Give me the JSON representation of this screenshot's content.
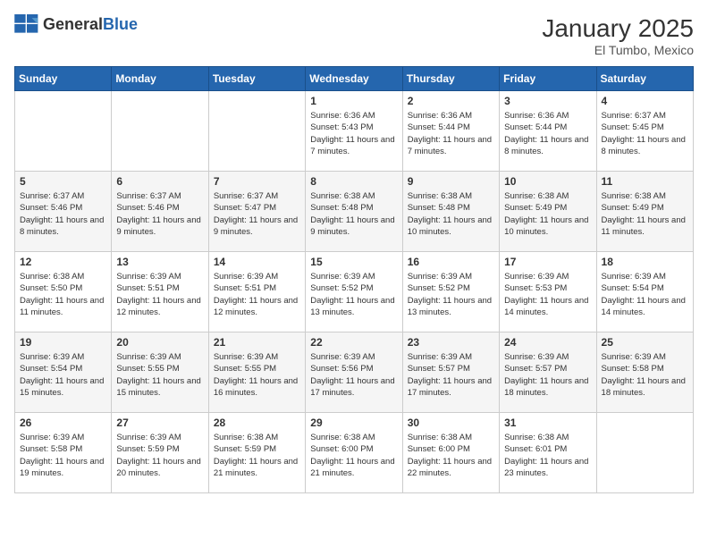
{
  "header": {
    "logo_general": "General",
    "logo_blue": "Blue",
    "month": "January 2025",
    "location": "El Tumbo, Mexico"
  },
  "days_of_week": [
    "Sunday",
    "Monday",
    "Tuesday",
    "Wednesday",
    "Thursday",
    "Friday",
    "Saturday"
  ],
  "weeks": [
    [
      {
        "day": "",
        "info": ""
      },
      {
        "day": "",
        "info": ""
      },
      {
        "day": "",
        "info": ""
      },
      {
        "day": "1",
        "info": "Sunrise: 6:36 AM\nSunset: 5:43 PM\nDaylight: 11 hours and 7 minutes."
      },
      {
        "day": "2",
        "info": "Sunrise: 6:36 AM\nSunset: 5:44 PM\nDaylight: 11 hours and 7 minutes."
      },
      {
        "day": "3",
        "info": "Sunrise: 6:36 AM\nSunset: 5:44 PM\nDaylight: 11 hours and 8 minutes."
      },
      {
        "day": "4",
        "info": "Sunrise: 6:37 AM\nSunset: 5:45 PM\nDaylight: 11 hours and 8 minutes."
      }
    ],
    [
      {
        "day": "5",
        "info": "Sunrise: 6:37 AM\nSunset: 5:46 PM\nDaylight: 11 hours and 8 minutes."
      },
      {
        "day": "6",
        "info": "Sunrise: 6:37 AM\nSunset: 5:46 PM\nDaylight: 11 hours and 9 minutes."
      },
      {
        "day": "7",
        "info": "Sunrise: 6:37 AM\nSunset: 5:47 PM\nDaylight: 11 hours and 9 minutes."
      },
      {
        "day": "8",
        "info": "Sunrise: 6:38 AM\nSunset: 5:48 PM\nDaylight: 11 hours and 9 minutes."
      },
      {
        "day": "9",
        "info": "Sunrise: 6:38 AM\nSunset: 5:48 PM\nDaylight: 11 hours and 10 minutes."
      },
      {
        "day": "10",
        "info": "Sunrise: 6:38 AM\nSunset: 5:49 PM\nDaylight: 11 hours and 10 minutes."
      },
      {
        "day": "11",
        "info": "Sunrise: 6:38 AM\nSunset: 5:49 PM\nDaylight: 11 hours and 11 minutes."
      }
    ],
    [
      {
        "day": "12",
        "info": "Sunrise: 6:38 AM\nSunset: 5:50 PM\nDaylight: 11 hours and 11 minutes."
      },
      {
        "day": "13",
        "info": "Sunrise: 6:39 AM\nSunset: 5:51 PM\nDaylight: 11 hours and 12 minutes."
      },
      {
        "day": "14",
        "info": "Sunrise: 6:39 AM\nSunset: 5:51 PM\nDaylight: 11 hours and 12 minutes."
      },
      {
        "day": "15",
        "info": "Sunrise: 6:39 AM\nSunset: 5:52 PM\nDaylight: 11 hours and 13 minutes."
      },
      {
        "day": "16",
        "info": "Sunrise: 6:39 AM\nSunset: 5:52 PM\nDaylight: 11 hours and 13 minutes."
      },
      {
        "day": "17",
        "info": "Sunrise: 6:39 AM\nSunset: 5:53 PM\nDaylight: 11 hours and 14 minutes."
      },
      {
        "day": "18",
        "info": "Sunrise: 6:39 AM\nSunset: 5:54 PM\nDaylight: 11 hours and 14 minutes."
      }
    ],
    [
      {
        "day": "19",
        "info": "Sunrise: 6:39 AM\nSunset: 5:54 PM\nDaylight: 11 hours and 15 minutes."
      },
      {
        "day": "20",
        "info": "Sunrise: 6:39 AM\nSunset: 5:55 PM\nDaylight: 11 hours and 15 minutes."
      },
      {
        "day": "21",
        "info": "Sunrise: 6:39 AM\nSunset: 5:55 PM\nDaylight: 11 hours and 16 minutes."
      },
      {
        "day": "22",
        "info": "Sunrise: 6:39 AM\nSunset: 5:56 PM\nDaylight: 11 hours and 17 minutes."
      },
      {
        "day": "23",
        "info": "Sunrise: 6:39 AM\nSunset: 5:57 PM\nDaylight: 11 hours and 17 minutes."
      },
      {
        "day": "24",
        "info": "Sunrise: 6:39 AM\nSunset: 5:57 PM\nDaylight: 11 hours and 18 minutes."
      },
      {
        "day": "25",
        "info": "Sunrise: 6:39 AM\nSunset: 5:58 PM\nDaylight: 11 hours and 18 minutes."
      }
    ],
    [
      {
        "day": "26",
        "info": "Sunrise: 6:39 AM\nSunset: 5:58 PM\nDaylight: 11 hours and 19 minutes."
      },
      {
        "day": "27",
        "info": "Sunrise: 6:39 AM\nSunset: 5:59 PM\nDaylight: 11 hours and 20 minutes."
      },
      {
        "day": "28",
        "info": "Sunrise: 6:38 AM\nSunset: 5:59 PM\nDaylight: 11 hours and 21 minutes."
      },
      {
        "day": "29",
        "info": "Sunrise: 6:38 AM\nSunset: 6:00 PM\nDaylight: 11 hours and 21 minutes."
      },
      {
        "day": "30",
        "info": "Sunrise: 6:38 AM\nSunset: 6:00 PM\nDaylight: 11 hours and 22 minutes."
      },
      {
        "day": "31",
        "info": "Sunrise: 6:38 AM\nSunset: 6:01 PM\nDaylight: 11 hours and 23 minutes."
      },
      {
        "day": "",
        "info": ""
      }
    ]
  ]
}
